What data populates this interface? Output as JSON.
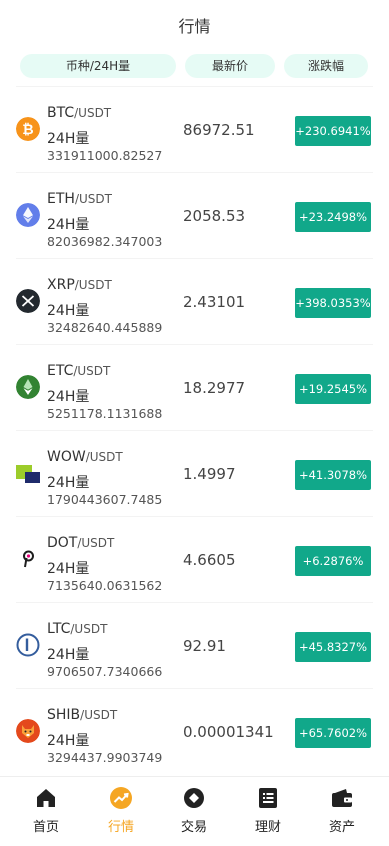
{
  "header": {
    "title": "行情"
  },
  "columns": {
    "pair": "币种/24H量",
    "price": "最新价",
    "change": "涨跌幅"
  },
  "vol_label": "24H量",
  "rows": [
    {
      "base": "BTC",
      "quote": "/USDT",
      "volume": "331911000.82527",
      "price": "86972.51",
      "change": "+230.6941%",
      "icon": "bitcoin-icon"
    },
    {
      "base": "ETH",
      "quote": "/USDT",
      "volume": "82036982.347003",
      "price": "2058.53",
      "change": "+23.2498%",
      "icon": "ethereum-icon"
    },
    {
      "base": "XRP",
      "quote": "/USDT",
      "volume": "32482640.445889",
      "price": "2.43101",
      "change": "+398.0353%",
      "icon": "xrp-icon"
    },
    {
      "base": "ETC",
      "quote": "/USDT",
      "volume": "5251178.1131688",
      "price": "18.2977",
      "change": "+19.2545%",
      "icon": "ethereum-classic-icon"
    },
    {
      "base": "WOW",
      "quote": "/USDT",
      "volume": "1790443607.7485",
      "price": "1.4997",
      "change": "+41.3078%",
      "icon": "wow-icon"
    },
    {
      "base": "DOT",
      "quote": "/USDT",
      "volume": "7135640.0631562",
      "price": "4.6605",
      "change": "+6.2876%",
      "icon": "polkadot-icon"
    },
    {
      "base": "LTC",
      "quote": "/USDT",
      "volume": "9706507.7340666",
      "price": "92.91",
      "change": "+45.8327%",
      "icon": "litecoin-icon"
    },
    {
      "base": "SHIB",
      "quote": "/USDT",
      "volume": "3294437.9903749",
      "price": "0.00001341",
      "change": "+65.7602%",
      "icon": "shiba-icon"
    }
  ],
  "tabs": [
    {
      "label": "首页",
      "icon": "home-icon",
      "active": false
    },
    {
      "label": "行情",
      "icon": "market-icon",
      "active": true
    },
    {
      "label": "交易",
      "icon": "trade-icon",
      "active": false
    },
    {
      "label": "理财",
      "icon": "finance-icon",
      "active": false
    },
    {
      "label": "资产",
      "icon": "wallet-icon",
      "active": false
    }
  ],
  "colors": {
    "accent": "#11a88a",
    "active_tab": "#f5a623",
    "pill_bg": "#e6fbf5"
  }
}
